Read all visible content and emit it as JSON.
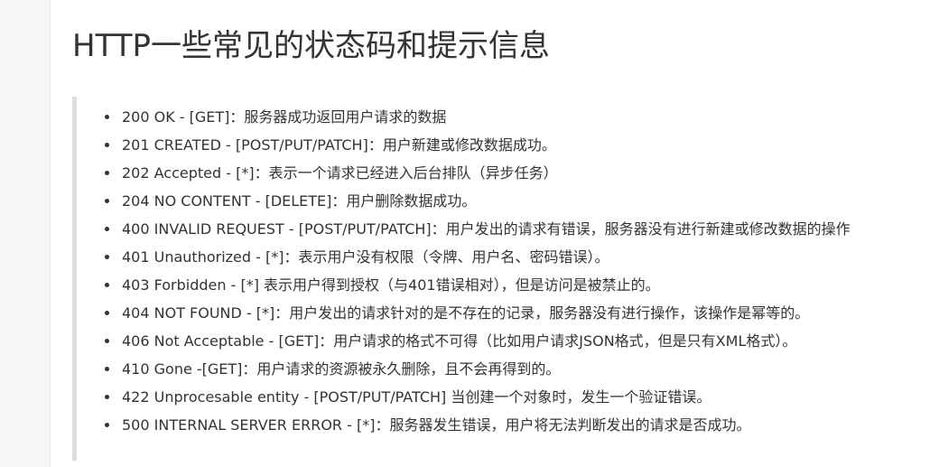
{
  "title": "HTTP一些常见的状态码和提示信息",
  "items": [
    "200 OK - [GET]：服务器成功返回用户请求的数据",
    "201 CREATED - [POST/PUT/PATCH]：用户新建或修改数据成功。",
    "202 Accepted - [*]：表示一个请求已经进入后台排队（异步任务）",
    "204 NO CONTENT - [DELETE]：用户删除数据成功。",
    "400 INVALID REQUEST - [POST/PUT/PATCH]：用户发出的请求有错误，服务器没有进行新建或修改数据的操作",
    "401 Unauthorized - [*]：表示用户没有权限（令牌、用户名、密码错误）。",
    "403 Forbidden - [*] 表示用户得到授权（与401错误相对），但是访问是被禁止的。",
    "404 NOT FOUND - [*]：用户发出的请求针对的是不存在的记录，服务器没有进行操作，该操作是幂等的。",
    "406 Not Acceptable - [GET]：用户请求的格式不可得（比如用户请求JSON格式，但是只有XML格式）。",
    "410 Gone -[GET]：用户请求的资源被永久删除，且不会再得到的。",
    "422 Unprocesable entity - [POST/PUT/PATCH] 当创建一个对象时，发生一个验证错误。",
    "500 INTERNAL SERVER ERROR - [*]：服务器发生错误，用户将无法判断发出的请求是否成功。"
  ]
}
